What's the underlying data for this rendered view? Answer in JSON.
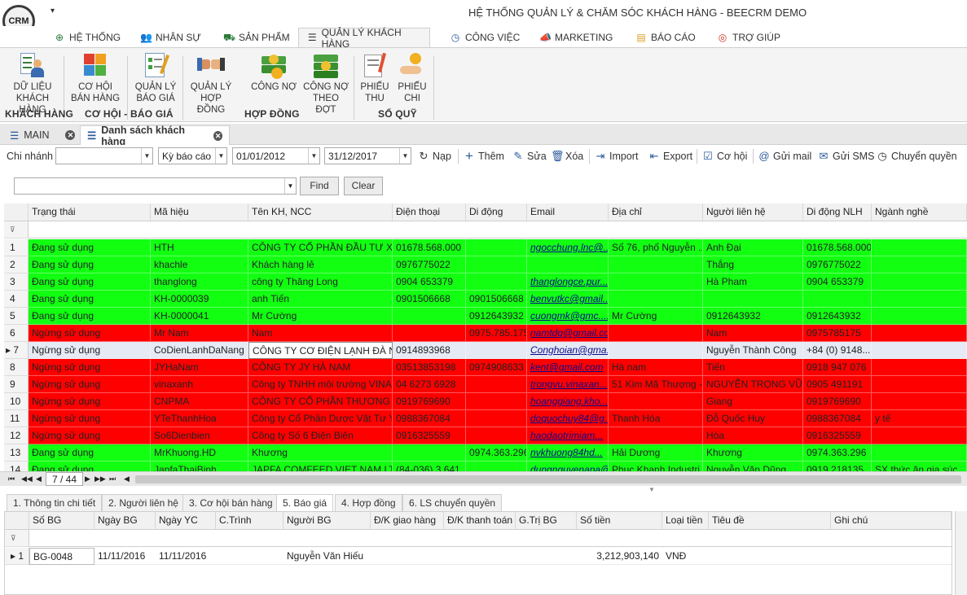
{
  "app": {
    "logo_text": "CRM",
    "title": "HỆ THỐNG QUẢN LÝ & CHĂM SÓC KHÁCH HÀNG - BEECRM DEMO",
    "quick_access": "▾"
  },
  "main_tabs": [
    {
      "label": "HỆ THỐNG",
      "icon": "network-icon"
    },
    {
      "label": "NHÂN SỰ",
      "icon": "people-icon"
    },
    {
      "label": "SẢN PHẨM",
      "icon": "cart-icon"
    },
    {
      "label": "QUẢN LÝ KHÁCH HÀNG",
      "icon": "list-icon",
      "active": true
    },
    {
      "label": "CÔNG VIỆC",
      "icon": "clock-icon"
    },
    {
      "label": "MARKETING",
      "icon": "megaphone-icon"
    },
    {
      "label": "BÁO CÁO",
      "icon": "folder-icon"
    },
    {
      "label": "TRỢ GIÚP",
      "icon": "lifebuoy-icon"
    }
  ],
  "ribbon": {
    "buttons": [
      {
        "line1": "DỮ LIỆU",
        "line2": "KHÁCH HÀNG"
      },
      {
        "line1": "CƠ HỘI",
        "line2": "BÁN HÀNG"
      },
      {
        "line1": "QUẢN LÝ",
        "line2": "BÁO GIÁ"
      },
      {
        "line1": "QUẢN LÝ",
        "line2": "HỢP ĐỒNG"
      },
      {
        "line1": "CÔNG NỢ",
        "line2": ""
      },
      {
        "line1": "CÔNG NỢ",
        "line2": "THEO ĐỢT"
      },
      {
        "line1": "PHIẾU",
        "line2": "THU"
      },
      {
        "line1": "PHIẾU",
        "line2": "CHI"
      }
    ],
    "groups": [
      "KHÁCH HÀNG",
      "CƠ HỘI - BÁO GIÁ",
      "HỢP ĐỒNG",
      "SỔ QUỸ"
    ]
  },
  "doc_tabs": [
    {
      "label": "MAIN"
    },
    {
      "label": "Danh sách khách hàng",
      "active": true
    }
  ],
  "toolbar": {
    "branch_label": "Chi nhánh",
    "branch_value": "",
    "period_value": "Kỳ báo cáo",
    "date_from": "01/01/2012",
    "date_to": "31/12/2017",
    "actions": [
      "Nạp",
      "Thêm",
      "Sửa",
      "Xóa",
      "Import",
      "Export",
      "Cơ hội",
      "Gửi mail",
      "Gửi SMS",
      "Chuyển quyền"
    ]
  },
  "search": {
    "value": "",
    "find_label": "Find",
    "clear_label": "Clear"
  },
  "grid": {
    "columns": [
      "Trạng thái",
      "Mã hiệu",
      "Tên KH, NCC",
      "Điện thoại",
      "Di động",
      "Email",
      "Địa chỉ",
      "Người liên hệ",
      "Di động NLH",
      "Ngành nghề"
    ],
    "rows": [
      {
        "no": "1",
        "status": "green",
        "cells": [
          "Đang sử dụng",
          "HTH",
          "CÔNG TY CỔ PHẦN ĐẦU TƯ XÂY ...",
          "01678.568.000",
          "",
          "ngocchung.lnc@...",
          "Số 76, phố Nguyễn ...",
          "Anh Đại",
          "01678.568.000",
          ""
        ]
      },
      {
        "no": "2",
        "status": "green",
        "cells": [
          "Đang sử dụng",
          "khachle",
          "Khách hàng lẻ",
          "0976775022",
          "",
          "",
          "",
          "Thắng",
          "0976775022",
          ""
        ]
      },
      {
        "no": "3",
        "status": "green",
        "cells": [
          "Đang sử dụng",
          "thanglong",
          "công ty Thăng Long",
          "0904 653379",
          "",
          "thanglongce.pur...",
          "",
          "Hà Pham",
          "0904 653379",
          ""
        ]
      },
      {
        "no": "4",
        "status": "green",
        "cells": [
          "Đang sử dụng",
          "KH-0000039",
          "anh Tiến",
          "0901506668",
          "0901506668",
          "benvutkc@gmail....",
          "",
          "",
          "",
          ""
        ]
      },
      {
        "no": "5",
        "status": "green",
        "cells": [
          "Đang sử dụng",
          "KH-0000041",
          "Mr Cường",
          "",
          "0912643932",
          "cuongmk@gmc....",
          "Mr Cường",
          "0912643932",
          "0912643932",
          ""
        ]
      },
      {
        "no": "6",
        "status": "red",
        "cells": [
          "Ngừng sử dụng",
          "Mr Nam",
          "Nam",
          "",
          "0975.785.175",
          "namtdq@gmail.com",
          "",
          "Nam",
          "0975785175",
          ""
        ]
      },
      {
        "no": "7",
        "status": "selected",
        "cells": [
          "Ngừng sử dụng",
          "CoDienLanhDaNang",
          "CÔNG TY CƠ ĐIỆN LẠNH ĐÀ NẴNG",
          "0914893968",
          "",
          "Conghoian@gma...",
          "",
          "Nguyễn Thành Công",
          "+84 (0) 9148...",
          ""
        ]
      },
      {
        "no": "8",
        "status": "red",
        "cells": [
          "Ngừng sử dụng",
          "JYHaNam",
          "CÔNG TY JY HÀ NAM",
          "03513853198",
          "0974908633",
          "kent@gmail.com",
          "Hà nam",
          "Tiến",
          "0918 947 076",
          ""
        ]
      },
      {
        "no": "9",
        "status": "red",
        "cells": [
          "Ngừng sử dụng",
          "vinaxanh",
          "Công ty TNHH môi trường VINAX...",
          "04 6273 6928",
          "",
          "trongvu.vinaxan...",
          "51 Kim Mã Thượng - ...",
          "NGUYỄN TRỌNG VŨ",
          "0905 491191",
          ""
        ]
      },
      {
        "no": "10",
        "status": "red",
        "cells": [
          "Ngừng sử dụng",
          "CNPMA",
          "CÔNG TY  CỔ PHẦN THƯƠNG MA...",
          "0919769690",
          "",
          "hoanggiang.kho...",
          "",
          "Giang",
          "0919769690",
          ""
        ]
      },
      {
        "no": "11",
        "status": "red",
        "cells": [
          "Ngừng sử dụng",
          "YTeThanhHoa",
          "Công ty Cổ Phần Dược Vật Tư Y ...",
          "0988367084",
          "",
          "doquochuy84@g...",
          "Thanh Hóa",
          "Đỗ Quốc Huy",
          "0988367084",
          "y tế"
        ]
      },
      {
        "no": "12",
        "status": "red",
        "cells": [
          "Ngừng sử dụng",
          "So6Dienbien",
          "Công ty Số 6 Điện Biên",
          "0916325559",
          "",
          "haodaotrimiam...",
          "",
          "Hòa",
          "0916325559",
          ""
        ]
      },
      {
        "no": "13",
        "status": "green",
        "cells": [
          "Đang sử dụng",
          "MrKhuong.HD",
          "Khương",
          "",
          "0974.363.296",
          "nvkhuong84hd...",
          "Hải Dương",
          "Khương",
          "0974.363.296",
          ""
        ]
      },
      {
        "no": "14",
        "status": "green",
        "cells": [
          "Đang sử dụng",
          "JapfaThaiBinh",
          "JAPFA COMFEED VIET NAM LTD",
          "(84-036) 3.641...",
          "",
          "dungnguyenapa@...",
          "Phuc Khanh Industri...",
          "Nguyễn Văn Dũng",
          "0919 218135",
          "SX thức ăn gia súc"
        ]
      }
    ],
    "pager": "7 / 44"
  },
  "detail_tabs": [
    {
      "label": "1. Thông tin chi tiết"
    },
    {
      "label": "2. Người liên hệ"
    },
    {
      "label": "3. Cơ hội bán hàng"
    },
    {
      "label": "5. Báo giá",
      "active": true
    },
    {
      "label": "4. Hợp đồng"
    },
    {
      "label": "6. LS chuyển quyền"
    }
  ],
  "detail_grid": {
    "columns": [
      "Số BG",
      "Ngày BG",
      "Ngày YC",
      "C.Trình",
      "Người BG",
      "Đ/K giao hàng",
      "Đ/K thanh toán",
      "G.Trị BG",
      "Số tiền",
      "Loại tiền",
      "Tiêu đề",
      "Ghi chú"
    ],
    "rows": [
      {
        "cells": [
          "BG-0048",
          "11/11/2016",
          "11/11/2016",
          "",
          "Nguyễn Văn Hiếu",
          "",
          "",
          "",
          "3,212,903,140",
          "VNĐ",
          "",
          ""
        ]
      }
    ]
  },
  "colors": {
    "active_green": "#12ff12",
    "inactive_red": "#ff0000",
    "selected_row": "#e6eaf4"
  }
}
